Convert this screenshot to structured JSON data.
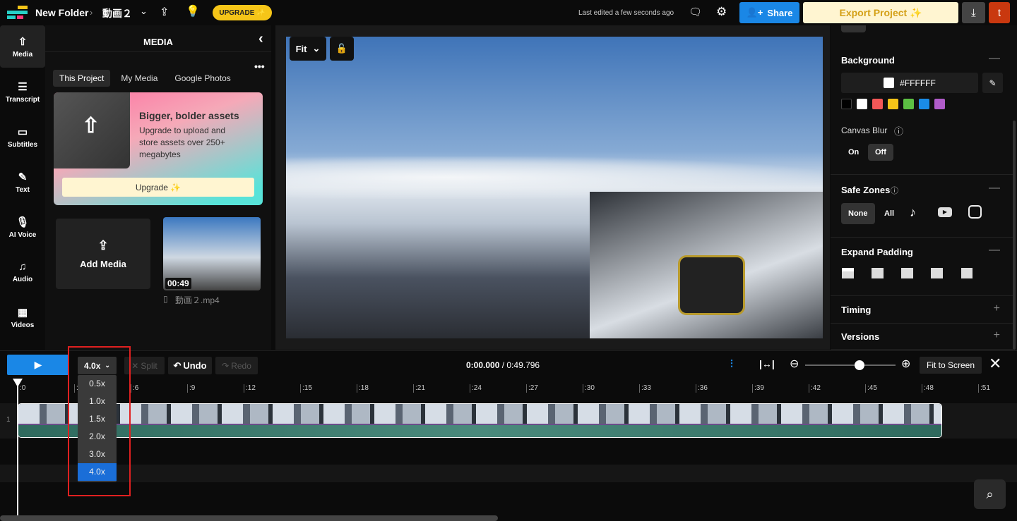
{
  "header": {
    "breadcrumb_folder": "New Folder",
    "project_name": "動画２",
    "upgrade_label": "UPGRADE ✨",
    "last_edited": "Last edited a few seconds ago",
    "share_label": "Share",
    "export_label": "Export Project ✨",
    "avatar_letter": "t"
  },
  "rail": [
    {
      "label": "Media",
      "icon": "cloud-upload-icon"
    },
    {
      "label": "Transcript",
      "icon": "transcript-icon"
    },
    {
      "label": "Subtitles",
      "icon": "subtitles-icon"
    },
    {
      "label": "Text",
      "icon": "text-edit-icon"
    },
    {
      "label": "AI Voice",
      "icon": "microphone-icon"
    },
    {
      "label": "Audio",
      "icon": "music-note-icon"
    },
    {
      "label": "Videos",
      "icon": "film-icon"
    }
  ],
  "media": {
    "title": "MEDIA",
    "tabs": [
      "This Project",
      "My Media",
      "Google Photos"
    ],
    "promo_title": "Bigger, bolder assets",
    "promo_text": "Upgrade to upload and store assets over 250+ megabytes",
    "promo_button": "Upgrade ✨",
    "add_media": "Add Media",
    "file_duration": "00:49",
    "file_name": "動画２.mp4"
  },
  "preview": {
    "fit_label": "Fit"
  },
  "properties": {
    "background_title": "Background",
    "color_value": "#FFFFFF",
    "swatches": [
      "#000000",
      "#FFFFFF",
      "#F25757",
      "#F5C518",
      "#5CC043",
      "#1A8CE8",
      "#B05CC9"
    ],
    "canvas_blur": "Canvas Blur",
    "on": "On",
    "off": "Off",
    "safe_zones": "Safe Zones",
    "none": "None",
    "all": "All",
    "expand_padding": "Expand Padding",
    "timing": "Timing",
    "versions": "Versions"
  },
  "timeline": {
    "speed": "4.0x",
    "split": "Split",
    "undo": "Undo",
    "redo": "Redo",
    "current_time": "0:00.000",
    "total_time": "/ 0:49.796",
    "fit_to_screen": "Fit to Screen",
    "zoom_level": 0.6,
    "track_number": "1",
    "ticks": [
      ":0",
      ":3",
      ":6",
      ":9",
      ":12",
      ":15",
      ":18",
      ":21",
      ":24",
      ":27",
      ":30",
      ":33",
      ":36",
      ":39",
      ":42",
      ":45",
      ":48",
      ":51"
    ],
    "speed_options": [
      "0.5x",
      "1.0x",
      "1.5x",
      "2.0x",
      "3.0x",
      "4.0x"
    ],
    "selected_speed": "4.0x"
  },
  "colors": {
    "accent": "#1a87e6",
    "upgrade": "#f5c518",
    "export_bg": "#fff5d1",
    "avatar": "#c9380f",
    "highlight_box": "#e02020"
  }
}
